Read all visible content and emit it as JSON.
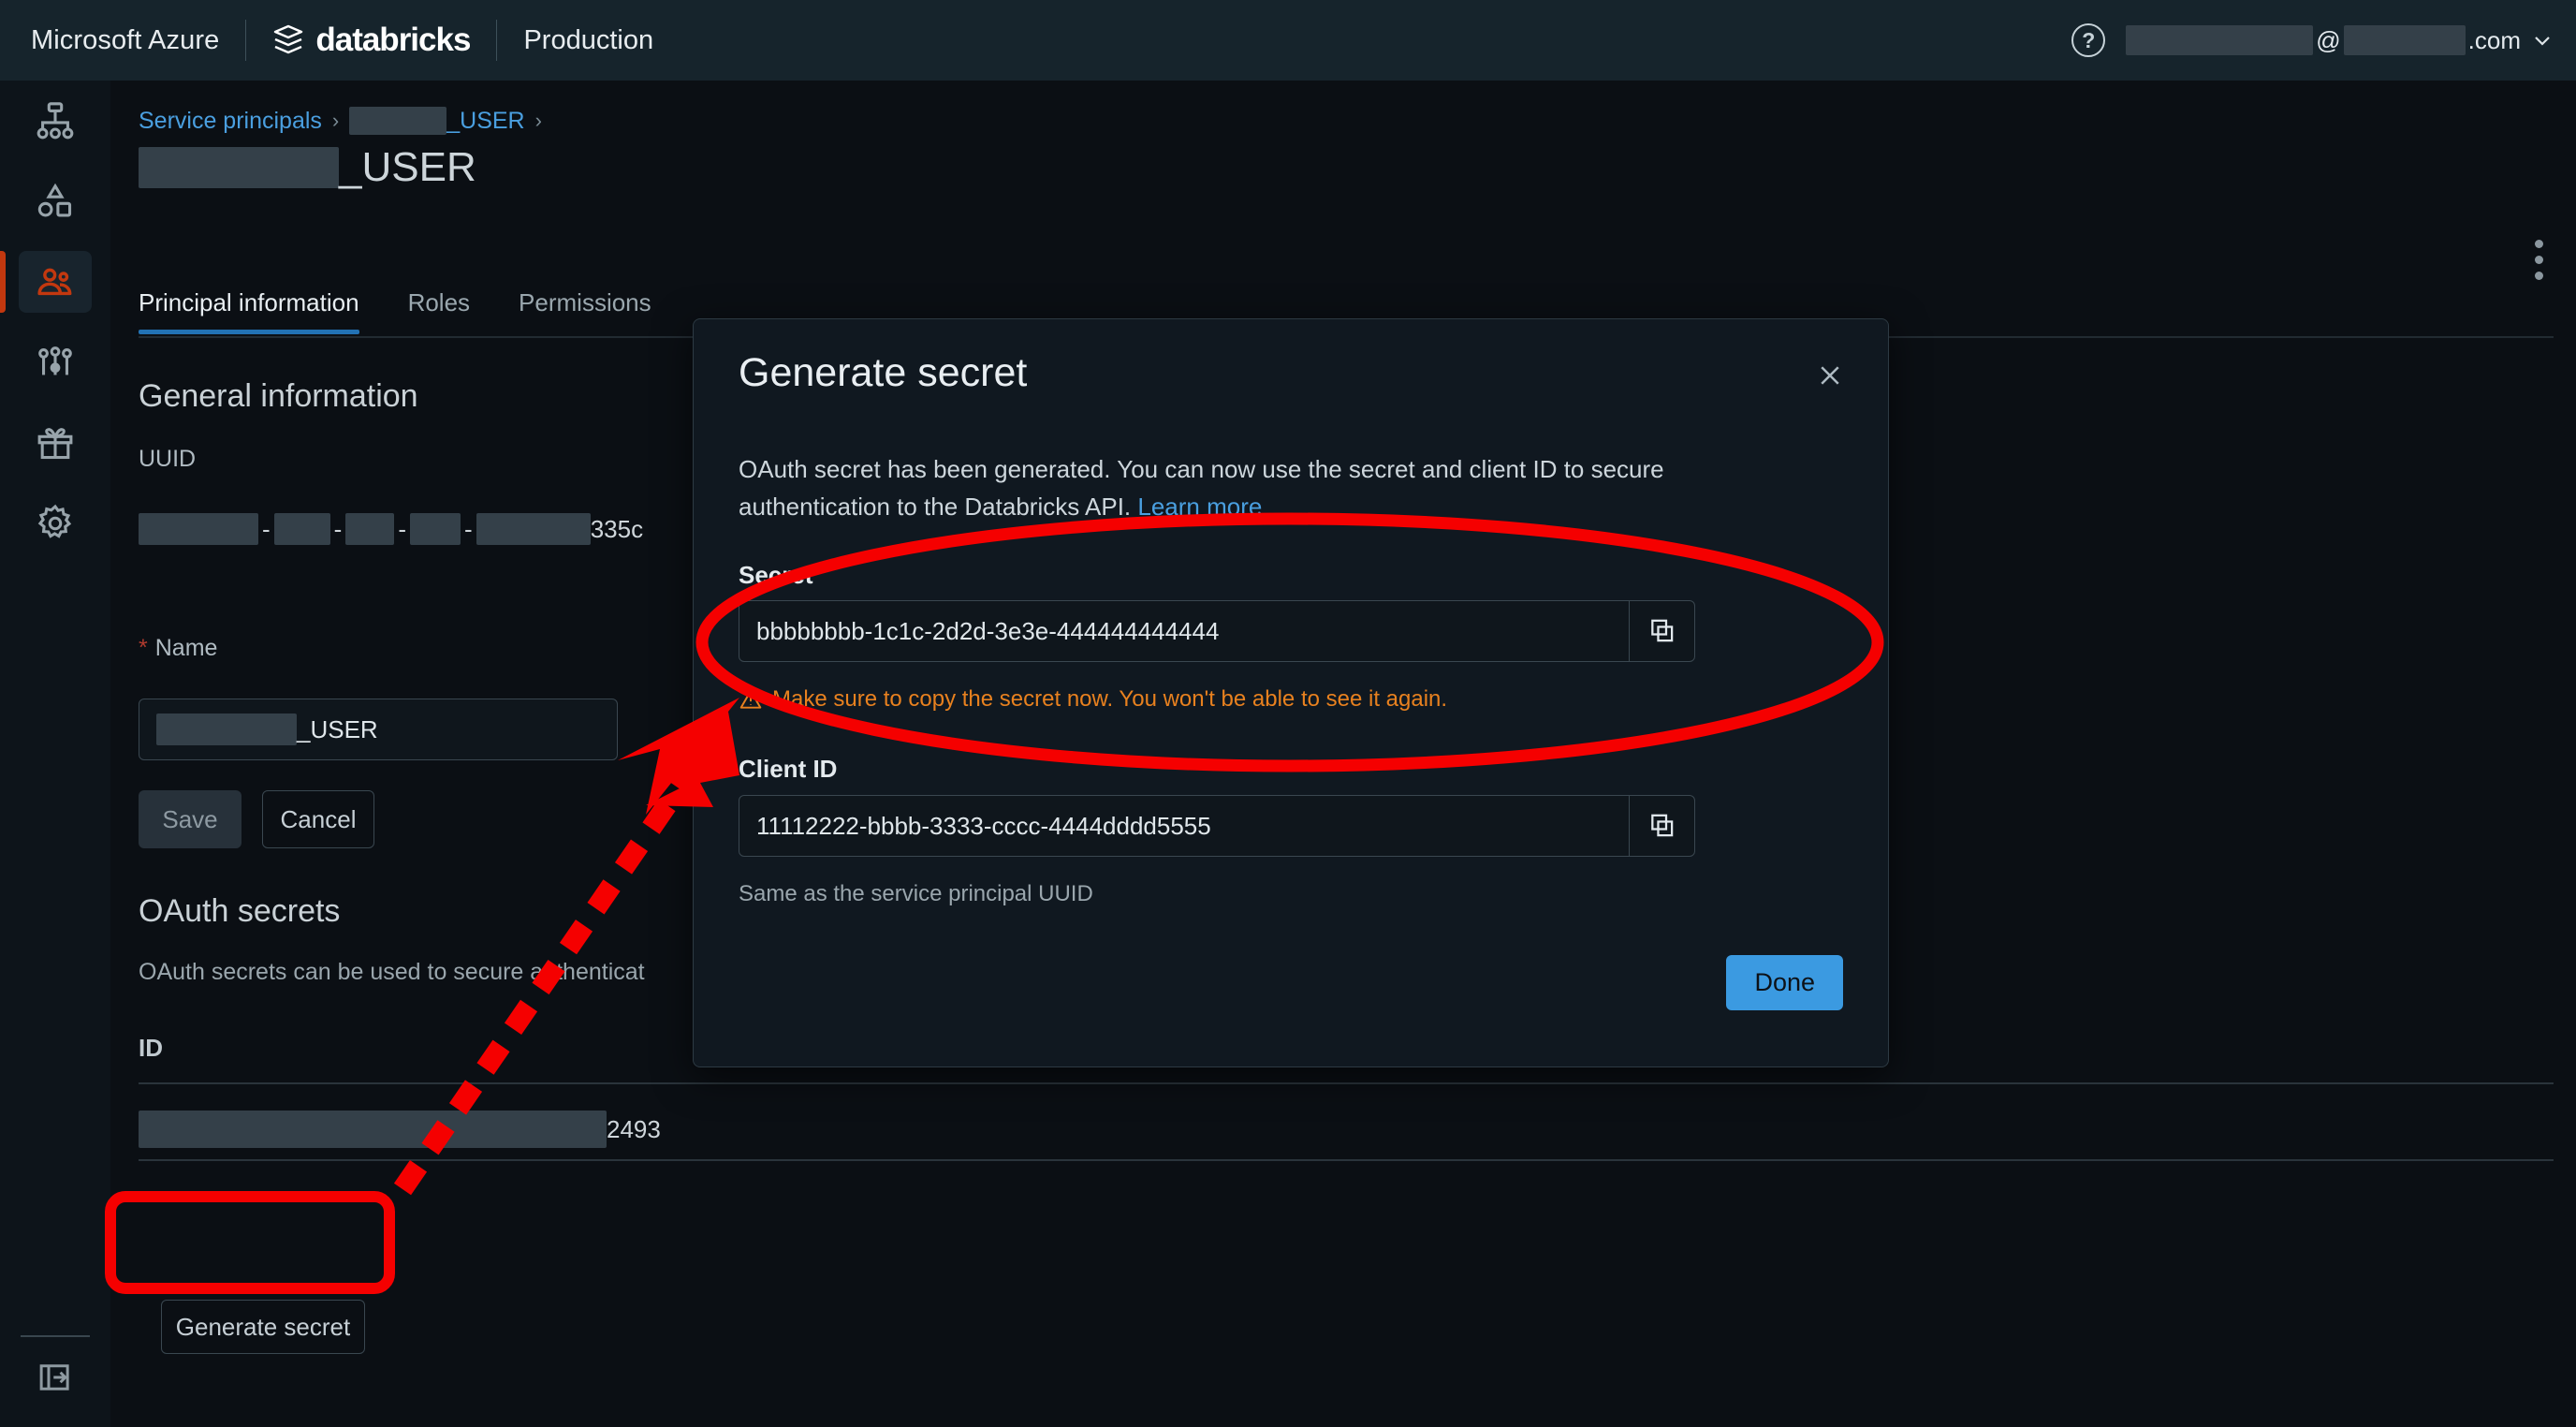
{
  "topbar": {
    "azure_label": "Microsoft Azure",
    "brand": "databricks",
    "workspace": "Production",
    "help_icon": "question-circle-icon",
    "account_at": "@",
    "account_suffix": ".com",
    "chevron": "⌄"
  },
  "sidebar": {
    "items": [
      {
        "name": "workflows-icon",
        "label": "Workflows",
        "active": false
      },
      {
        "name": "catalog-shapes-icon",
        "label": "Catalog",
        "active": false
      },
      {
        "name": "users-icon",
        "label": "Identity and access",
        "active": true
      },
      {
        "name": "sliders-icon",
        "label": "Settings controls",
        "active": false
      },
      {
        "name": "gift-icon",
        "label": "Previews",
        "active": false
      },
      {
        "name": "gear-icon",
        "label": "Settings",
        "active": false
      }
    ],
    "expand_icon": "expand-sidebar-icon"
  },
  "breadcrumb": {
    "root": "Service principals",
    "sep": "›",
    "current_suffix": "_USER"
  },
  "page": {
    "title_suffix": "_USER",
    "kebab_icon": "more-vertical-icon"
  },
  "tabs": [
    {
      "label": "Principal information",
      "selected": true
    },
    {
      "label": "Roles",
      "selected": false
    },
    {
      "label": "Permissions",
      "selected": false
    }
  ],
  "general": {
    "heading": "General information",
    "uuid_label": "UUID",
    "uuid_visible_tail": "335c",
    "name_label": "Name",
    "name_required_mark": "*",
    "name_value_suffix": "_USER",
    "save_label": "Save",
    "cancel_label": "Cancel"
  },
  "oauth": {
    "heading": "OAuth secrets",
    "description": "OAuth secrets can be used to secure authenticat",
    "table": {
      "columns": [
        "ID"
      ],
      "rows": [
        {
          "id_visible_tail": "2493"
        }
      ]
    },
    "generate_label": "Generate secret"
  },
  "modal": {
    "title": "Generate secret",
    "close_icon": "close-icon",
    "body_text": "OAuth secret has been generated. You can now use the secret and client ID to secure authentication to the Databricks API.",
    "learn_more": "Learn more",
    "secret_label": "Secret",
    "secret_value": "bbbbbbbb-1c1c-2d2d-3e3e-444444444444",
    "secret_copy_icon": "copy-icon",
    "warning_icon": "warning-triangle-icon",
    "warning_text": "Make sure to copy the secret now. You won't be able to see it again.",
    "client_id_label": "Client ID",
    "client_id_value": "11112222-bbbb-3333-cccc-4444dddd5555",
    "client_id_copy_icon": "copy-icon",
    "client_id_help": "Same as the service principal UUID",
    "done_label": "Done"
  },
  "annotations": {
    "highlight_color": "#f50000",
    "ellipse_target": "secret-field-group",
    "box_target": "generate-secret-button",
    "arrow": "dashed-arrow-pointing-to-secret"
  },
  "colors": {
    "accent_blue": "#3b9ae1",
    "link_blue": "#4a9fe0",
    "warning_orange": "#e8811f",
    "active_rail": "#c2380f",
    "topbar_bg": "#16242c",
    "page_bg": "#0b0f14",
    "modal_bg": "#101820"
  }
}
